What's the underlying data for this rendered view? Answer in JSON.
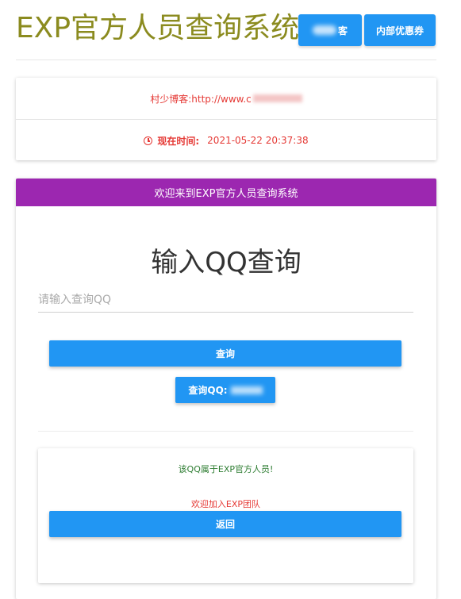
{
  "header": {
    "title": "EXP官方人员查询系统",
    "button_1_label": "客",
    "button_2_label": "内部优惠券"
  },
  "info": {
    "blog_text": "村少博客:http://www.c",
    "time_label": "现在时间:",
    "time_value": "2021-05-22 20:37:38"
  },
  "panel": {
    "header": "欢迎来到EXP官方人员查询系统",
    "big_title": "输入QQ查询",
    "input_placeholder": "请输入查询QQ",
    "input_value": "",
    "query_button": "查询",
    "qq_button": "查询QQ:"
  },
  "result": {
    "message": "该QQ属于EXP官方人员!",
    "welcome": "欢迎加入EXP团队",
    "back_button": "返回"
  },
  "colors": {
    "title": "#8b8b1f",
    "primary": "#2196f3",
    "panel_header": "#9c27b0",
    "alert": "#e53935",
    "success": "#2e7d32"
  },
  "icons": {
    "time": "clock-icon"
  }
}
